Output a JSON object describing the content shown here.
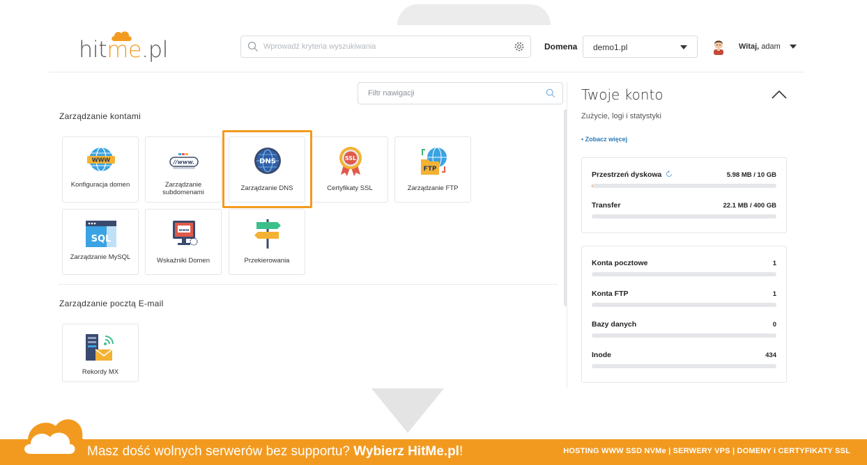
{
  "header": {
    "logo_part1": "hit",
    "logo_part2": "me",
    "logo_part3": ".pl",
    "search_placeholder": "Wprowadź kryteria wyszukiwania",
    "domain_label": "Domena",
    "domain_value": "demo1.pl",
    "greeting": "Witaj,",
    "username": "adam"
  },
  "nav": {
    "filter_placeholder": "Filtr nawigacji",
    "sections": [
      {
        "title": "Zarządzanie kontami",
        "tiles": [
          {
            "label": "Konfiguracja domen",
            "icon": "globe-www-icon"
          },
          {
            "label": "Zarządzanie subdomenami",
            "icon": "subdomain-www-icon"
          },
          {
            "label": "Zarządzanie DNS",
            "icon": "dns-globe-icon"
          },
          {
            "label": "Certyfikaty SSL",
            "icon": "ssl-badge-icon"
          },
          {
            "label": "Zarządzanie FTP",
            "icon": "ftp-folder-icon"
          },
          {
            "label": "Zarządzanie MySQL",
            "icon": "sql-database-icon"
          },
          {
            "label": "Wskaźniki Domen",
            "icon": "domain-pointer-icon"
          },
          {
            "label": "Przekierowania",
            "icon": "signpost-icon"
          }
        ]
      },
      {
        "title": "Zarządzanie pocztą E-mail",
        "tiles": [
          {
            "label": "Rekordy MX",
            "icon": "mx-server-mail-icon"
          }
        ]
      }
    ]
  },
  "account": {
    "title": "Twoje konto",
    "subtitle": "Zużycie, logi i statystyki",
    "more_link": "• Zobacz więcej",
    "usage": [
      {
        "name": "Przestrzeń dyskowa",
        "value": "5.98 MB / 10 GB",
        "fraction": 0.0006
      },
      {
        "name": "Transfer",
        "value": "22.1 MB / 400 GB",
        "fraction": 0.0001
      }
    ],
    "counts": [
      {
        "name": "Konta pocztowe",
        "value": "1"
      },
      {
        "name": "Konta FTP",
        "value": "1"
      },
      {
        "name": "Bazy danych",
        "value": "0"
      },
      {
        "name": "Inode",
        "value": "434"
      }
    ]
  },
  "banner": {
    "text_main": "Masz dość wolnych serwerów bez supportu?",
    "text_brand": "Wybierz HitMe.pl",
    "text_end": "!",
    "right_text": "HOSTING WWW SSD NVMe | SERWERY VPS | DOMENY i CERTYFIKATY SSL"
  },
  "colors": {
    "accent": "#f39a21",
    "link": "#2b7bb9"
  }
}
